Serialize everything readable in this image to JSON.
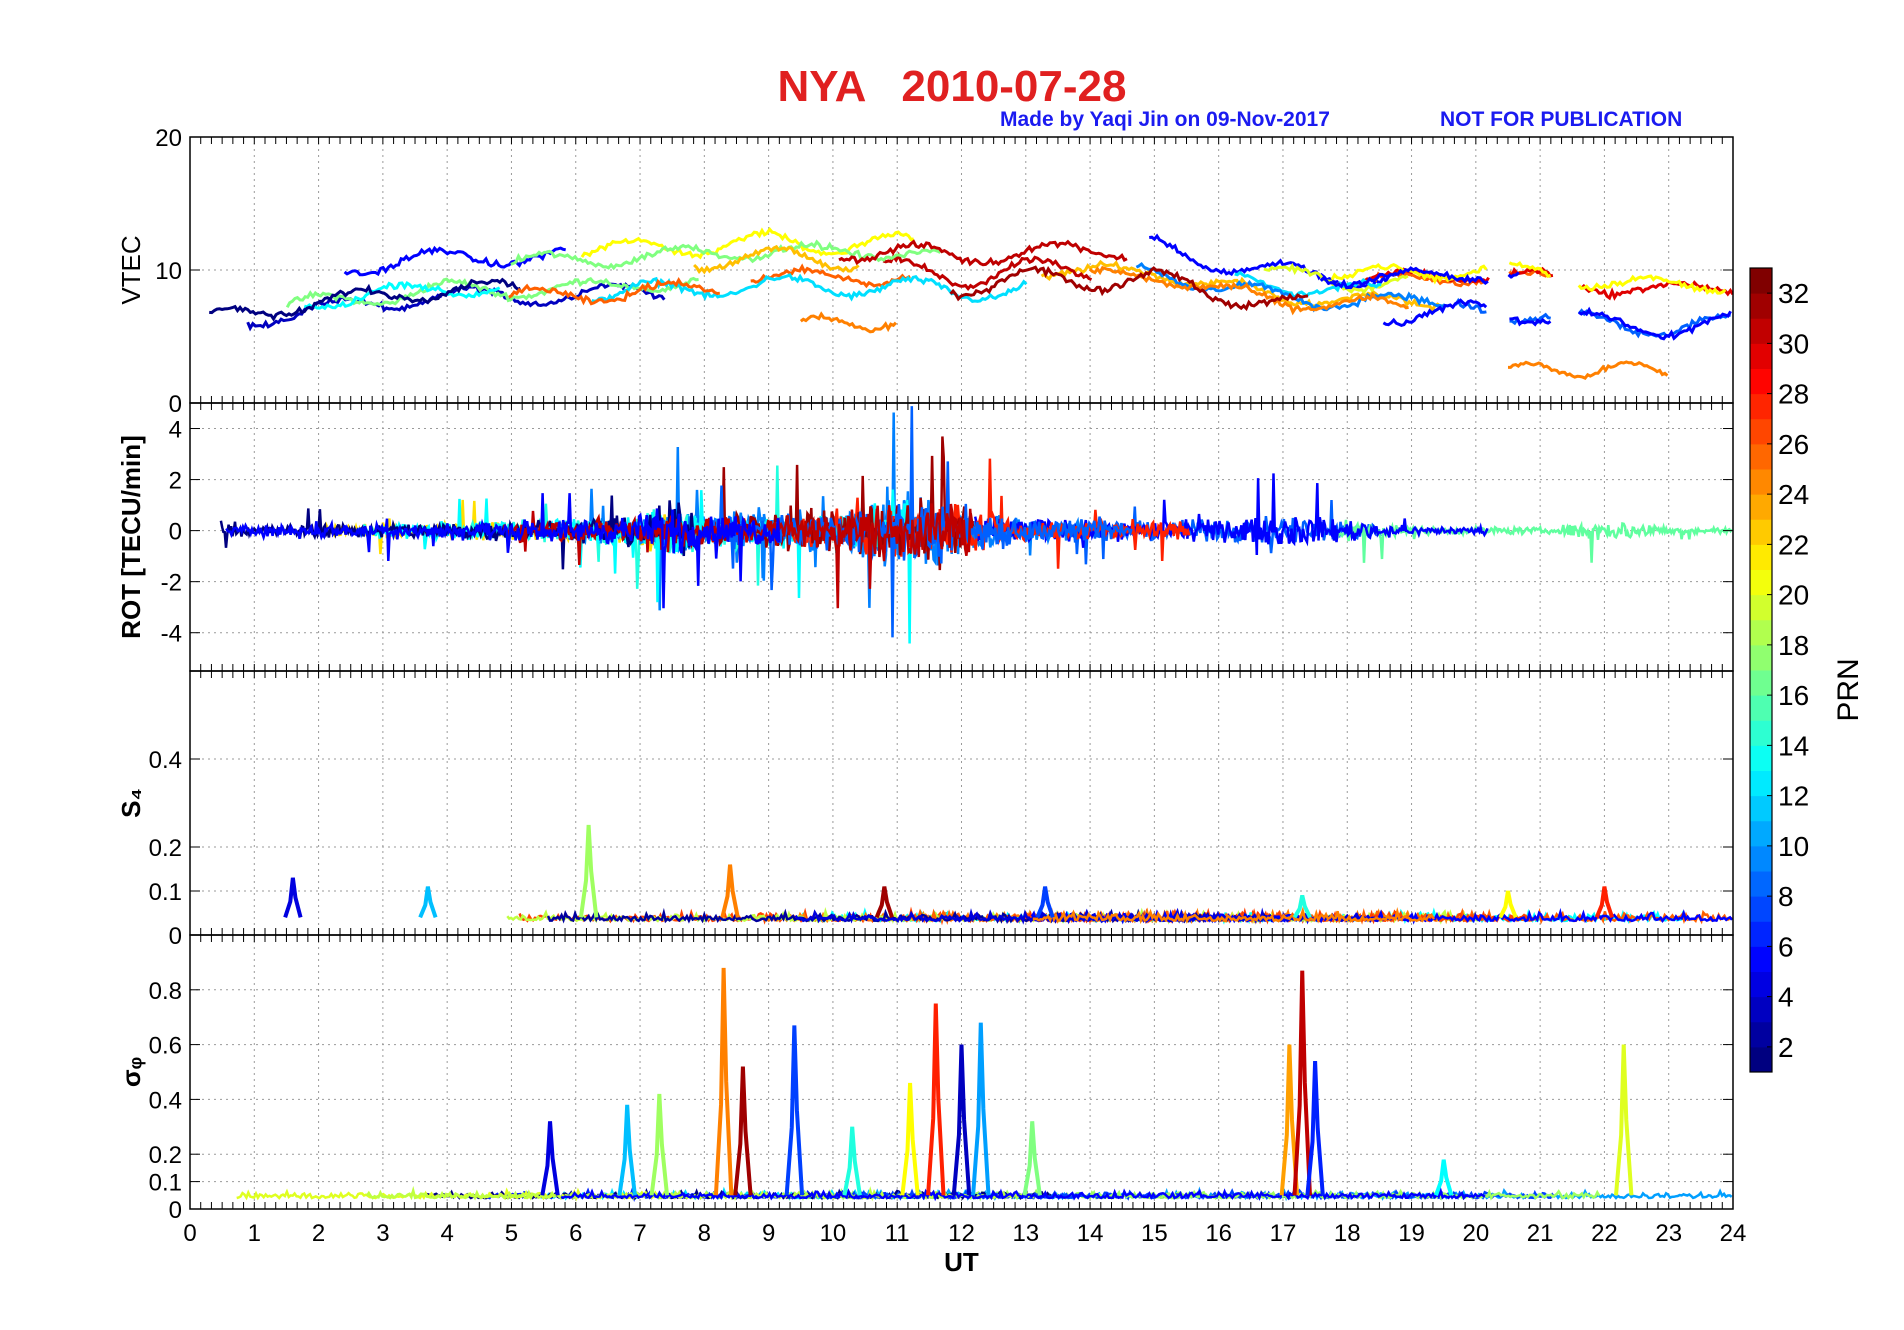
{
  "header": {
    "title": "NYA   2010-07-28",
    "credit": "Made by Yaqi Jin on 09-Nov-2017",
    "notice": "NOT FOR PUBLICATION",
    "title_color": "#e02020",
    "credit_color": "#1b1bf0"
  },
  "colorbar": {
    "label": "PRN",
    "ticks": [
      2,
      4,
      6,
      8,
      10,
      12,
      14,
      16,
      18,
      20,
      22,
      24,
      26,
      28,
      30,
      32
    ],
    "range": [
      1,
      33
    ],
    "colormap": "jet"
  },
  "chart_data": [
    {
      "type": "line",
      "panel": "vtec",
      "ylabel": "VTEC",
      "ylim": [
        0,
        20
      ],
      "yticks": [
        0,
        10,
        20
      ],
      "xlim": [
        0,
        24
      ],
      "grid": true,
      "series_summary": [
        {
          "x": [
            0,
            2,
            4,
            6,
            7,
            8,
            9,
            10,
            11,
            12,
            13,
            14,
            15,
            16,
            17,
            18,
            19,
            20,
            21,
            22,
            23,
            24
          ],
          "y": [
            7,
            8.5,
            9.5,
            9.5,
            10,
            10,
            10.5,
            10,
            10.5,
            9.5,
            10.5,
            10,
            10.5,
            9,
            8.5,
            8,
            8,
            8.5,
            8,
            7.5,
            7,
            7.5
          ]
        }
      ],
      "notable": [
        {
          "label": "PRN ~25 low arcs",
          "x": [
            9.5,
            11
          ],
          "y": 6
        },
        {
          "label": "PRN ~25 low arcs",
          "x": [
            20.5,
            23
          ],
          "y": 2.5
        }
      ]
    },
    {
      "type": "line",
      "panel": "rot",
      "ylabel": "ROT [TECU/min]",
      "ylim": [
        -5.5,
        5
      ],
      "yticks": [
        -4,
        -2,
        0,
        2,
        4
      ],
      "xlim": [
        0,
        24
      ],
      "grid": true,
      "envelope": {
        "x": [
          0,
          3,
          5,
          6,
          7,
          7.5,
          8,
          9,
          10,
          11,
          11.5,
          12,
          13,
          14,
          15,
          16,
          17,
          18,
          19,
          20,
          21,
          22,
          23,
          24
        ],
        "amplitude": [
          0.8,
          1.2,
          1.6,
          1.8,
          2.5,
          4.4,
          2.5,
          2.5,
          3.0,
          5.0,
          4.8,
          4.5,
          2.0,
          1.5,
          1.5,
          1.6,
          2.5,
          1.8,
          0.6,
          0.6,
          0.5,
          1.8,
          0.6,
          0.5
        ]
      }
    },
    {
      "type": "line",
      "panel": "s4",
      "ylabel": "S₄",
      "ylim": [
        0,
        0.6
      ],
      "yticks": [
        0,
        0.1,
        0.2,
        0.4
      ],
      "xlim": [
        0,
        24
      ],
      "grid": true,
      "baseline": 0.04,
      "spikes": [
        {
          "x": 1.6,
          "y": 0.13
        },
        {
          "x": 3.7,
          "y": 0.11
        },
        {
          "x": 6.2,
          "y": 0.25
        },
        {
          "x": 8.4,
          "y": 0.16
        },
        {
          "x": 10.8,
          "y": 0.11
        },
        {
          "x": 13.3,
          "y": 0.11
        },
        {
          "x": 17.3,
          "y": 0.09
        },
        {
          "x": 20.5,
          "y": 0.1
        },
        {
          "x": 22.0,
          "y": 0.11
        }
      ]
    },
    {
      "type": "line",
      "panel": "sigma_phi",
      "ylabel": "σᵩ",
      "ylim": [
        0,
        1.0
      ],
      "yticks": [
        0,
        0.1,
        0.2,
        0.4,
        0.6,
        0.8
      ],
      "xlabel": "UT",
      "xticks": [
        0,
        1,
        2,
        3,
        4,
        5,
        6,
        7,
        8,
        9,
        10,
        11,
        12,
        13,
        14,
        15,
        16,
        17,
        18,
        19,
        20,
        21,
        22,
        23,
        24
      ],
      "xlim": [
        0,
        24
      ],
      "grid": true,
      "baseline": 0.05,
      "spikes": [
        {
          "x": 5.6,
          "y": 0.32
        },
        {
          "x": 6.8,
          "y": 0.38
        },
        {
          "x": 7.3,
          "y": 0.42
        },
        {
          "x": 8.3,
          "y": 0.88
        },
        {
          "x": 8.6,
          "y": 0.52
        },
        {
          "x": 9.4,
          "y": 0.67
        },
        {
          "x": 10.3,
          "y": 0.3
        },
        {
          "x": 11.2,
          "y": 0.46
        },
        {
          "x": 11.6,
          "y": 0.75
        },
        {
          "x": 12.0,
          "y": 0.6
        },
        {
          "x": 12.3,
          "y": 0.68
        },
        {
          "x": 13.1,
          "y": 0.32
        },
        {
          "x": 17.1,
          "y": 0.6
        },
        {
          "x": 17.3,
          "y": 0.87
        },
        {
          "x": 17.5,
          "y": 0.54
        },
        {
          "x": 19.5,
          "y": 0.18
        },
        {
          "x": 22.3,
          "y": 0.6
        }
      ]
    }
  ]
}
